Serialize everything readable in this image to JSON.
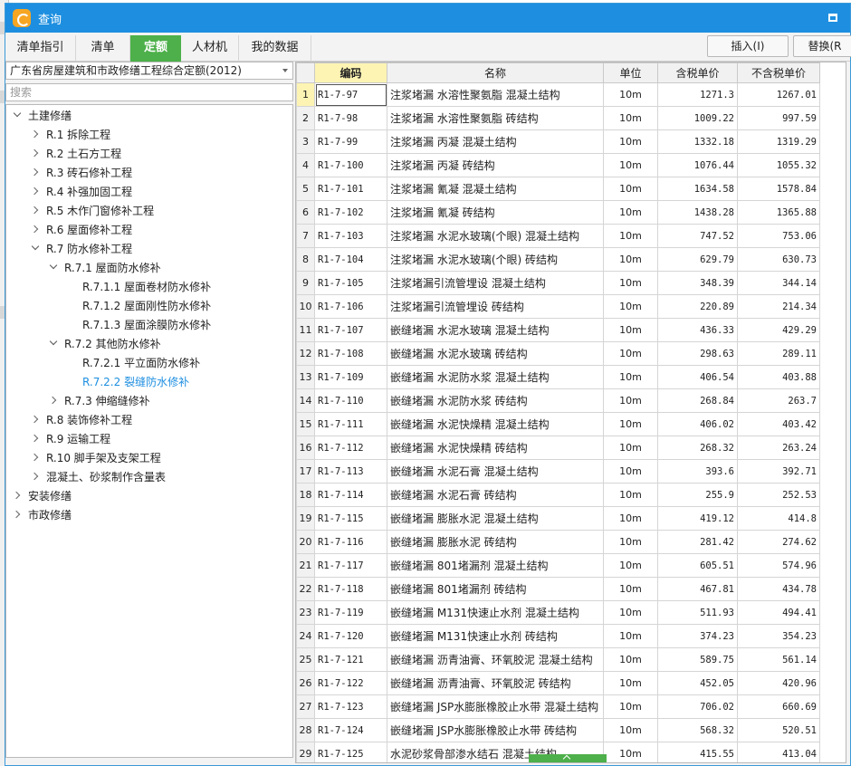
{
  "window": {
    "title": "查询"
  },
  "tabs": [
    {
      "label": "清单指引",
      "active": false
    },
    {
      "label": "清单",
      "active": false
    },
    {
      "label": "定额",
      "active": true
    },
    {
      "label": "人材机",
      "active": false
    },
    {
      "label": "我的数据",
      "active": false
    }
  ],
  "toolbar": {
    "insert_label": "插入(I)",
    "replace_label": "替换(R"
  },
  "left": {
    "library": "广东省房屋建筑和市政修缮工程综合定额(2012)",
    "search_placeholder": "搜索",
    "tree": [
      {
        "label": "土建修缮",
        "level": 0,
        "state": "expanded"
      },
      {
        "label": "R.1 拆除工程",
        "level": 1,
        "state": "collapsed"
      },
      {
        "label": "R.2 土石方工程",
        "level": 1,
        "state": "collapsed"
      },
      {
        "label": "R.3 砖石修补工程",
        "level": 1,
        "state": "collapsed"
      },
      {
        "label": "R.4 补强加固工程",
        "level": 1,
        "state": "collapsed"
      },
      {
        "label": "R.5 木作门窗修补工程",
        "level": 1,
        "state": "collapsed"
      },
      {
        "label": "R.6 屋面修补工程",
        "level": 1,
        "state": "collapsed"
      },
      {
        "label": "R.7 防水修补工程",
        "level": 1,
        "state": "expanded"
      },
      {
        "label": "R.7.1 屋面防水修补",
        "level": 2,
        "state": "expanded"
      },
      {
        "label": "R.7.1.1 屋面卷材防水修补",
        "level": 3,
        "state": "leaf"
      },
      {
        "label": "R.7.1.2 屋面刚性防水修补",
        "level": 3,
        "state": "leaf"
      },
      {
        "label": "R.7.1.3 屋面涂膜防水修补",
        "level": 3,
        "state": "leaf"
      },
      {
        "label": "R.7.2 其他防水修补",
        "level": 2,
        "state": "expanded"
      },
      {
        "label": "R.7.2.1 平立面防水修补",
        "level": 3,
        "state": "leaf"
      },
      {
        "label": "R.7.2.2 裂缝防水修补",
        "level": 3,
        "state": "leaf",
        "selected": true
      },
      {
        "label": "R.7.3 伸缩缝修补",
        "level": 2,
        "state": "collapsed"
      },
      {
        "label": "R.8 装饰修补工程",
        "level": 1,
        "state": "collapsed"
      },
      {
        "label": "R.9 运输工程",
        "level": 1,
        "state": "collapsed"
      },
      {
        "label": "R.10 脚手架及支架工程",
        "level": 1,
        "state": "collapsed"
      },
      {
        "label": "混凝土、砂浆制作含量表",
        "level": 1,
        "state": "collapsed"
      },
      {
        "label": "安装修缮",
        "level": 0,
        "state": "collapsed"
      },
      {
        "label": "市政修缮",
        "level": 0,
        "state": "collapsed"
      }
    ]
  },
  "table": {
    "columns": [
      "编码",
      "名称",
      "单位",
      "含税单价",
      "不含税单价"
    ],
    "rows": [
      [
        "1",
        "R1-7-97",
        "注浆堵漏 水溶性聚氨脂 混凝土结构",
        "10m",
        "1271.3",
        "1267.01"
      ],
      [
        "2",
        "R1-7-98",
        "注浆堵漏 水溶性聚氨脂 砖结构",
        "10m",
        "1009.22",
        "997.59"
      ],
      [
        "3",
        "R1-7-99",
        "注浆堵漏 丙凝 混凝土结构",
        "10m",
        "1332.18",
        "1319.29"
      ],
      [
        "4",
        "R1-7-100",
        "注浆堵漏 丙凝 砖结构",
        "10m",
        "1076.44",
        "1055.32"
      ],
      [
        "5",
        "R1-7-101",
        "注浆堵漏 氰凝 混凝土结构",
        "10m",
        "1634.58",
        "1578.84"
      ],
      [
        "6",
        "R1-7-102",
        "注浆堵漏 氰凝 砖结构",
        "10m",
        "1438.28",
        "1365.88"
      ],
      [
        "7",
        "R1-7-103",
        "注浆堵漏 水泥水玻璃(个眼) 混凝土结构",
        "10m",
        "747.52",
        "753.06"
      ],
      [
        "8",
        "R1-7-104",
        "注浆堵漏 水泥水玻璃(个眼) 砖结构",
        "10m",
        "629.79",
        "630.73"
      ],
      [
        "9",
        "R1-7-105",
        "注浆堵漏引流管埋设 混凝土结构",
        "10m",
        "348.39",
        "344.14"
      ],
      [
        "10",
        "R1-7-106",
        "注浆堵漏引流管埋设 砖结构",
        "10m",
        "220.89",
        "214.34"
      ],
      [
        "11",
        "R1-7-107",
        "嵌缝堵漏 水泥水玻璃 混凝土结构",
        "10m",
        "436.33",
        "429.29"
      ],
      [
        "12",
        "R1-7-108",
        "嵌缝堵漏 水泥水玻璃 砖结构",
        "10m",
        "298.63",
        "289.11"
      ],
      [
        "13",
        "R1-7-109",
        "嵌缝堵漏 水泥防水浆 混凝土结构",
        "10m",
        "406.54",
        "403.88"
      ],
      [
        "14",
        "R1-7-110",
        "嵌缝堵漏 水泥防水浆 砖结构",
        "10m",
        "268.84",
        "263.7"
      ],
      [
        "15",
        "R1-7-111",
        "嵌缝堵漏 水泥快燥精 混凝土结构",
        "10m",
        "406.02",
        "403.42"
      ],
      [
        "16",
        "R1-7-112",
        "嵌缝堵漏 水泥快燥精 砖结构",
        "10m",
        "268.32",
        "263.24"
      ],
      [
        "17",
        "R1-7-113",
        "嵌缝堵漏 水泥石膏 混凝土结构",
        "10m",
        "393.6",
        "392.71"
      ],
      [
        "18",
        "R1-7-114",
        "嵌缝堵漏 水泥石膏 砖结构",
        "10m",
        "255.9",
        "252.53"
      ],
      [
        "19",
        "R1-7-115",
        "嵌缝堵漏 膨胀水泥 混凝土结构",
        "10m",
        "419.12",
        "414.8"
      ],
      [
        "20",
        "R1-7-116",
        "嵌缝堵漏 膨胀水泥 砖结构",
        "10m",
        "281.42",
        "274.62"
      ],
      [
        "21",
        "R1-7-117",
        "嵌缝堵漏 801堵漏剂 混凝土结构",
        "10m",
        "605.51",
        "574.96"
      ],
      [
        "22",
        "R1-7-118",
        "嵌缝堵漏 801堵漏剂 砖结构",
        "10m",
        "467.81",
        "434.78"
      ],
      [
        "23",
        "R1-7-119",
        "嵌缝堵漏 M131快速止水剂 混凝土结构",
        "10m",
        "511.93",
        "494.41"
      ],
      [
        "24",
        "R1-7-120",
        "嵌缝堵漏 M131快速止水剂 砖结构",
        "10m",
        "374.23",
        "354.23"
      ],
      [
        "25",
        "R1-7-121",
        "嵌缝堵漏 沥青油膏、环氧胶泥 混凝土结构",
        "10m",
        "589.75",
        "561.14"
      ],
      [
        "26",
        "R1-7-122",
        "嵌缝堵漏 沥青油膏、环氧胶泥 砖结构",
        "10m",
        "452.05",
        "420.96"
      ],
      [
        "27",
        "R1-7-123",
        "嵌缝堵漏 JSP水膨胀橡胶止水带 混凝土结构",
        "10m",
        "706.02",
        "660.69"
      ],
      [
        "28",
        "R1-7-124",
        "嵌缝堵漏 JSP水膨胀橡胶止水带 砖结构",
        "10m",
        "568.32",
        "520.51"
      ],
      [
        "29",
        "R1-7-125",
        "水泥砂浆骨部渗水结石 混凝土结构",
        "10m",
        "415.55",
        "413.04"
      ]
    ]
  },
  "colors": {
    "title_bar": "#1e8fe0",
    "active_tab": "#4db04a",
    "highlight": "#fdf4b3",
    "selected_text": "#1e8fe0"
  }
}
